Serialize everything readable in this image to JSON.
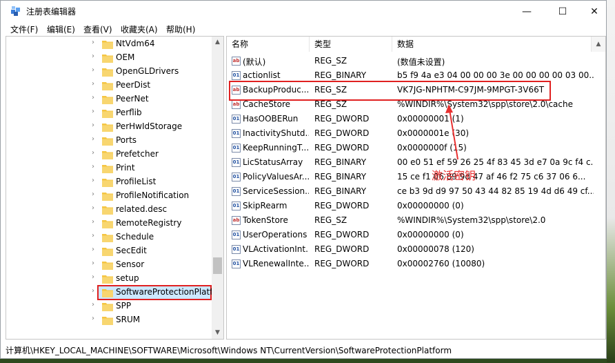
{
  "window": {
    "title": "注册表编辑器",
    "controls": {
      "minimize": "—",
      "maximize": "☐",
      "close": "✕"
    }
  },
  "menu": [
    "文件(F)",
    "编辑(E)",
    "查看(V)",
    "收藏夹(A)",
    "帮助(H)"
  ],
  "tree": {
    "items": [
      "NtVdm64",
      "OEM",
      "OpenGLDrivers",
      "PeerDist",
      "PeerNet",
      "Perflib",
      "PerHwIdStorage",
      "Ports",
      "Prefetcher",
      "Print",
      "ProfileList",
      "ProfileNotification",
      "related.desc",
      "RemoteRegistry",
      "Schedule",
      "SecEdit",
      "Sensor",
      "setup",
      "SoftwareProtectionPlatfo",
      "SPP",
      "SRUM"
    ],
    "selected": "SoftwareProtectionPlatfo"
  },
  "list": {
    "columns": {
      "name": "名称",
      "type": "类型",
      "data": "数据"
    },
    "rows": [
      {
        "name": "(默认)",
        "type": "REG_SZ",
        "data": "(数值未设置)",
        "icon": "string-value-icon"
      },
      {
        "name": "actionlist",
        "type": "REG_BINARY",
        "data": "b5 f9 4a e3 04 00 00 00 3e 00 00 00 00 03 00...",
        "icon": "binary-value-icon"
      },
      {
        "name": "BackupProduc...",
        "type": "REG_SZ",
        "data": "VK7JG-NPHTM-C97JM-9MPGT-3V66T",
        "icon": "string-value-icon"
      },
      {
        "name": "CacheStore",
        "type": "REG_SZ",
        "data": "%WINDIR%\\System32\\spp\\store\\2.0\\cache",
        "icon": "string-value-icon"
      },
      {
        "name": "HasOOBERun",
        "type": "REG_DWORD",
        "data": "0x00000001 (1)",
        "icon": "binary-value-icon"
      },
      {
        "name": "InactivityShutd...",
        "type": "REG_DWORD",
        "data": "0x0000001e (30)",
        "icon": "binary-value-icon"
      },
      {
        "name": "KeepRunningT...",
        "type": "REG_DWORD",
        "data": "0x0000000f (15)",
        "icon": "binary-value-icon"
      },
      {
        "name": "LicStatusArray",
        "type": "REG_BINARY",
        "data": "00 e0 51 ef 59 26 25 4f 83 45 3d e7 0a 9c f4 c...",
        "icon": "binary-value-icon"
      },
      {
        "name": "PolicyValuesAr...",
        "type": "REG_BINARY",
        "data": "15 ce f1 06 89 9d 47 af 46 f2 75 c6 37 06 6...",
        "icon": "binary-value-icon"
      },
      {
        "name": "ServiceSession...",
        "type": "REG_BINARY",
        "data": "ce b3 9d d9 97 50 43 44 82 85 19 4d d6 49 cf...",
        "icon": "binary-value-icon"
      },
      {
        "name": "SkipRearm",
        "type": "REG_DWORD",
        "data": "0x00000000 (0)",
        "icon": "binary-value-icon"
      },
      {
        "name": "TokenStore",
        "type": "REG_SZ",
        "data": "%WINDIR%\\System32\\spp\\store\\2.0",
        "icon": "string-value-icon"
      },
      {
        "name": "UserOperations",
        "type": "REG_DWORD",
        "data": "0x00000000 (0)",
        "icon": "binary-value-icon"
      },
      {
        "name": "VLActivationInt...",
        "type": "REG_DWORD",
        "data": "0x00000078 (120)",
        "icon": "binary-value-icon"
      },
      {
        "name": "VLRenewalInte...",
        "type": "REG_DWORD",
        "data": "0x00002760 (10080)",
        "icon": "binary-value-icon"
      }
    ],
    "highlighted_row": "BackupProduc..."
  },
  "annotation": {
    "text": "激活密钥",
    "color": "#e83030"
  },
  "statusbar": {
    "path": "计算机\\HKEY_LOCAL_MACHINE\\SOFTWARE\\Microsoft\\Windows NT\\CurrentVersion\\SoftwareProtectionPlatform"
  },
  "colors": {
    "selection": "#cce8ff",
    "highlight_border": "#e02020",
    "folder": "#f5c542"
  }
}
